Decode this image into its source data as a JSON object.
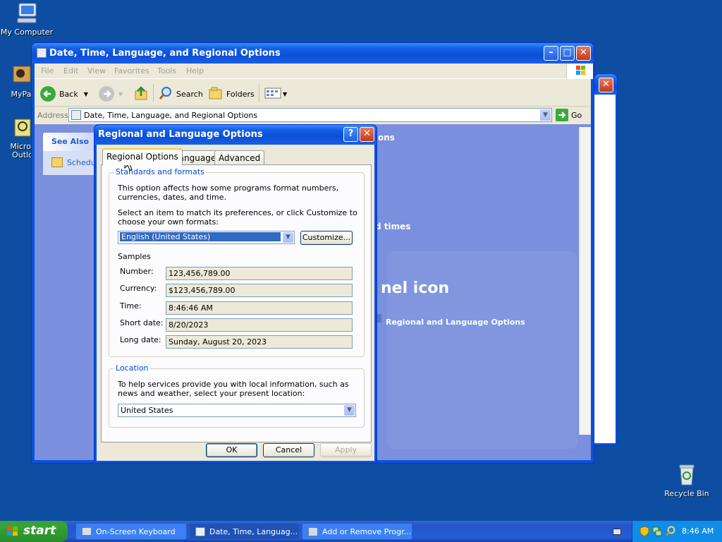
{
  "desktop": {
    "icons": [
      {
        "label": "My Computer"
      },
      {
        "label": "MyPa"
      },
      {
        "label": "Micros Outlo"
      },
      {
        "label": "Recycle Bin"
      }
    ]
  },
  "explorer": {
    "title": "Date, Time, Language, and Regional Options",
    "menu": [
      "File",
      "Edit",
      "View",
      "Favorites",
      "Tools",
      "Help"
    ],
    "toolbar": {
      "back": "Back",
      "search": "Search",
      "folders": "Folders"
    },
    "address_label": "Address",
    "address_value": "Date, Time, Language, and Regional Options",
    "go": "Go",
    "see_also": "See Also",
    "see_also_item": "Schedu",
    "content_fragments": {
      "pick_task_tail": "ons",
      "times_tail": "d times",
      "panel_icon_tail": "nel icon",
      "regional_link": "Regional and Language Options"
    }
  },
  "dialog": {
    "title": "Regional and Language Options",
    "help_btn": "?",
    "close_btn": "✕",
    "tabs": [
      "Regional Options",
      "Languages",
      "Advanced"
    ],
    "standards": {
      "label": "Standards and formats",
      "desc": "This option affects how some programs format numbers, currencies, dates, and time.",
      "select_desc": "Select an item to match its preferences, or click Customize to choose your own formats:",
      "selected_locale": "English (United States)",
      "customize": "Customize...",
      "samples_label": "Samples",
      "samples": [
        {
          "label": "Number:",
          "value": "123,456,789.00"
        },
        {
          "label": "Currency:",
          "value": "$123,456,789.00"
        },
        {
          "label": "Time:",
          "value": "8:46:46 AM"
        },
        {
          "label": "Short date:",
          "value": "8/20/2023"
        },
        {
          "label": "Long date:",
          "value": "Sunday, August 20, 2023"
        }
      ]
    },
    "location": {
      "label": "Location",
      "desc": "To help services provide you with local information, such as news and weather, select your present location:",
      "value": "United States"
    },
    "buttons": {
      "ok": "OK",
      "cancel": "Cancel",
      "apply": "Apply"
    }
  },
  "taskbar": {
    "start": "start",
    "tasks": [
      {
        "label": "On-Screen Keyboard"
      },
      {
        "label": "Date, Time, Languag..."
      },
      {
        "label": "Add or Remove Progr..."
      }
    ],
    "clock": "8:46 AM"
  }
}
